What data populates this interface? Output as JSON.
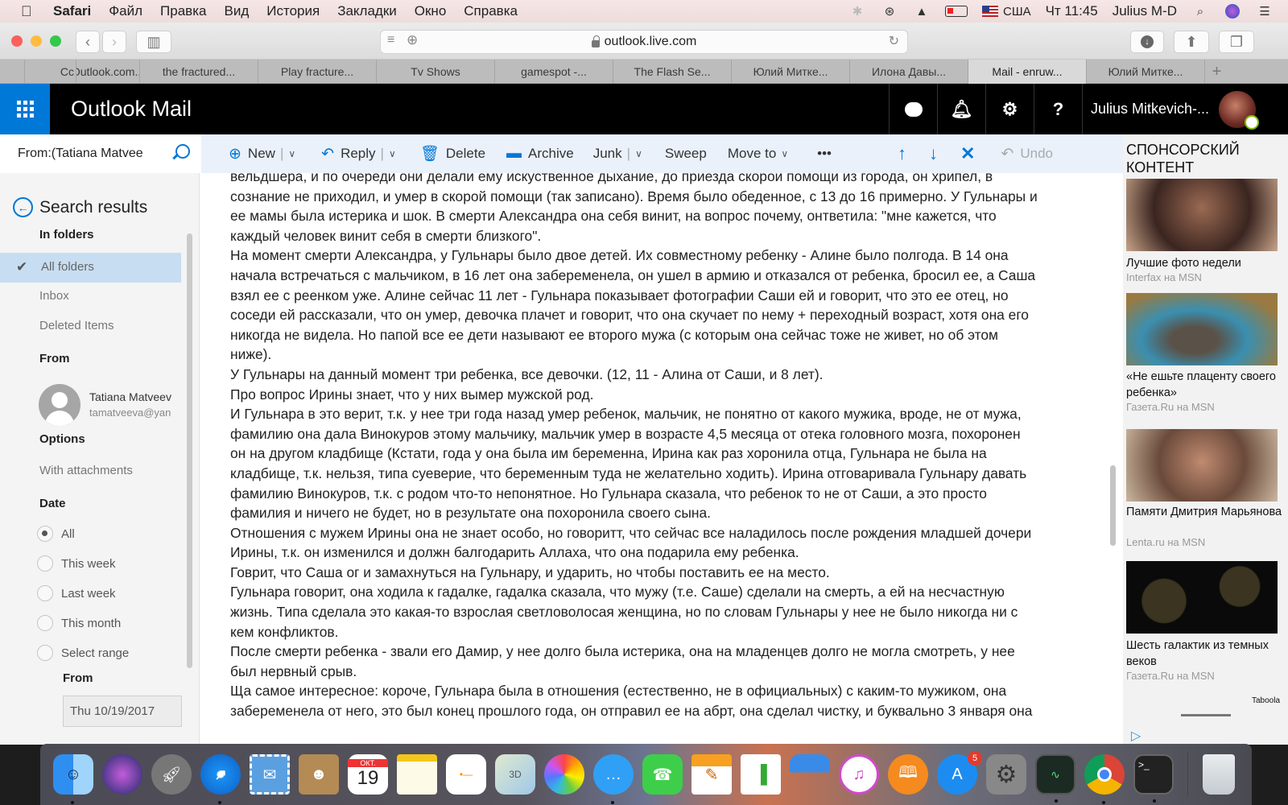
{
  "menubar": {
    "app": "Safari",
    "items": [
      "Файл",
      "Правка",
      "Вид",
      "История",
      "Закладки",
      "Окно",
      "Справка"
    ],
    "input_source": "США",
    "clock": "Чт 11:45",
    "user": "Julius M-D"
  },
  "browser": {
    "url": "outlook.live.com",
    "tabs": [
      {
        "label": "Cc",
        "active": false
      },
      {
        "label": "Outlook.com...",
        "active": false
      },
      {
        "label": "the fractured...",
        "active": false
      },
      {
        "label": "Play fracture...",
        "active": false
      },
      {
        "label": "Tv Shows",
        "active": false
      },
      {
        "label": "gamespot -...",
        "active": false
      },
      {
        "label": "The Flash Se...",
        "active": false
      },
      {
        "label": "Юлий Митке...",
        "active": false
      },
      {
        "label": "Илона Давы...",
        "active": false
      },
      {
        "label": "Mail - enruw...",
        "active": true
      },
      {
        "label": "Юлий Митке...",
        "active": false
      }
    ],
    "new_tab": "+"
  },
  "outlook": {
    "title": "Outlook Mail",
    "user_name": "Julius Mitkevich-...",
    "header_icons": [
      "chat-icon",
      "bell-icon",
      "gear-icon",
      "help-icon"
    ],
    "help_glyph": "?",
    "accent": "#0078d7"
  },
  "search": {
    "value": "From:(Tatiana Matvee"
  },
  "commands": {
    "new": "New",
    "reply": "Reply",
    "delete": "Delete",
    "archive": "Archive",
    "junk": "Junk",
    "sweep": "Sweep",
    "move_to": "Move to",
    "more": "•••",
    "undo": "Undo"
  },
  "filters": {
    "title": "Search results",
    "in_folders": "In folders",
    "folders": [
      "All folders",
      "Inbox",
      "Deleted Items"
    ],
    "selected_folder": "All folders",
    "from_heading": "From",
    "person_name": "Tatiana Matveeva",
    "person_email": "tamatveeva@yandex.ru",
    "options_heading": "Options",
    "with_attachments": "With attachments",
    "date_heading": "Date",
    "date_options": [
      "All",
      "This week",
      "Last week",
      "This month",
      "Select range"
    ],
    "date_selected": "All",
    "range_from_label": "From",
    "range_from_value": "Thu 10/19/2017"
  },
  "message": {
    "lines": [
      "вельдшера, и по очереди они делали ему искуственное дыхание, до приезда скорой помощи из города, он хрипел, в",
      "сознание не приходил, и умер в скорой помощи (так записано). Время было обеденное, с 13 до 16 примерно. У Гульнары и",
      "ее мамы была истерика и шок. В смерти Александра она себя винит, на вопрос почему, онтветила: \"мне кажется, что",
      "каждый человек винит себя в смерти близкого\".",
      "На момент смерти Александра, у Гульнары было двое детей. Их совместному ребенку - Алине было полгода. В 14 она",
      "начала встречаться с мальчиком, в 16 лет она забеременела, он ушел в армию и отказался от ребенка, бросил ее, а Саша",
      "взял ее с реенком уже. Алине сейчас 11 лет - Гульнара показывает фотографии Саши ей и говорит, что это ее отец, но",
      "соседи ей рассказали, что он умер, девочка плачет и говорит, что она скучает по нему + переходный возраст, хотя она его",
      "никогда не видела. Но папой все ее дети называют ее второго мужа (с которым она сейчас тоже не живет, но об этом",
      "ниже).",
      "У Гульнары на данный момент три ребенка, все девочки. (12, 11 - Алина от Саши, и 8 лет).",
      "Про вопрос Ирины знает, что у них вымер мужской род.",
      "И Гульнара в это верит, т.к. у нее три года назад умер ребенок, мальчик, не понятно от какого мужика, вроде, не от мужа,",
      "фамилию она дала Винокуров этому мальчику, мальчик умер в возрасте 4,5 месяца от отека головного мозга, похоронен",
      "он на другом кладбище (Кстати, года у она была им беременна, Ирина как раз хоронила отца, Гульнара не была на",
      "кладбище, т.к. нельзя, типа суеверие, что беременным туда не желательно ходить). Ирина отговаривала Гульнару давать",
      "фамилию Винокуров, т.к. с родом что-то непонятное. Но Гульнара сказала, что ребенок то не от Саши, а это просто",
      "фамилия и ничего не будет, но в результате она похоронила своего сына.",
      "Отношения с мужем Ирины она не знает особо, но говоритт, что сейчас все наладилось после рождения младшей дочери",
      "Ирины, т.к. он изменился и должн балгодарить Аллаха, что она подарила ему ребенка.",
      "Говрит, что Саша ог и замахнуться на Гульнару, и ударить, но чтобы поставить ее на место.",
      "Гульнара говорит, она ходила к гадалке, гадалка сказала, что мужу (т.е. Саше) сделали на смерть, а ей на несчастную",
      "жизнь. Типа сделала это какая-то взрослая светловолосая женщина, но по словам Гульнары у нее не было никогда ни с",
      "кем конфликтов.",
      "После смерти ребенка - звали его Дамир, у нее долго была истерика, она на младенцев долго не могла смотреть, у нее",
      "был нервный срыв.",
      "Ща самое интересное: короче, Гульнара была в отношения (естественно, не в официальных) с каким-то мужиком, она",
      "забеременела от него, это был конец прошлого года, он отправил ее на абрт, она сделал чистку, и буквально 3 января она"
    ]
  },
  "ads": {
    "heading_line1": "СПОНСОРСКИЙ",
    "heading_line2": "КОНТЕНТ",
    "items": [
      {
        "title": "Лучшие фото недели",
        "source": "Interfax на MSN"
      },
      {
        "title": "«Не ешьте плаценту своего ребенка»",
        "source": "Газета.Ru на MSN"
      },
      {
        "title": "Памяти Дмитрия Марьянова",
        "source": "Lenta.ru на MSN"
      },
      {
        "title": "Шесть галактик из темных веков",
        "source": "Газета.Ru на MSN"
      }
    ],
    "provider": "Taboola"
  },
  "dock": {
    "apps": [
      "Finder",
      "Siri",
      "Launchpad",
      "Safari",
      "Mail",
      "Contacts",
      "Calendar",
      "Notes",
      "Reminders",
      "Maps",
      "Photos",
      "Messages",
      "FaceTime",
      "Pages",
      "Numbers",
      "Keynote",
      "iTunes",
      "iBooks",
      "App Store",
      "System Preferences",
      "Activity Monitor",
      "Google Chrome",
      "Terminal",
      "Trash"
    ],
    "calendar_month": "ОКТ.",
    "calendar_day": "19",
    "app_store_badge": "5"
  }
}
